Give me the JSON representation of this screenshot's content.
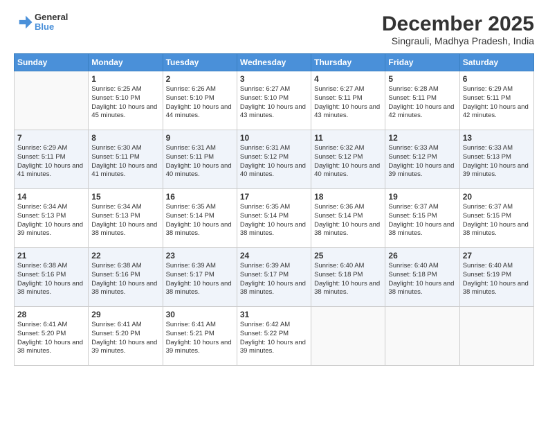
{
  "logo": {
    "line1": "General",
    "line2": "Blue"
  },
  "title": "December 2025",
  "subtitle": "Singrauli, Madhya Pradesh, India",
  "headers": [
    "Sunday",
    "Monday",
    "Tuesday",
    "Wednesday",
    "Thursday",
    "Friday",
    "Saturday"
  ],
  "weeks": [
    [
      {
        "day": "",
        "info": ""
      },
      {
        "day": "1",
        "info": "Sunrise: 6:25 AM\nSunset: 5:10 PM\nDaylight: 10 hours and 45 minutes."
      },
      {
        "day": "2",
        "info": "Sunrise: 6:26 AM\nSunset: 5:10 PM\nDaylight: 10 hours and 44 minutes."
      },
      {
        "day": "3",
        "info": "Sunrise: 6:27 AM\nSunset: 5:10 PM\nDaylight: 10 hours and 43 minutes."
      },
      {
        "day": "4",
        "info": "Sunrise: 6:27 AM\nSunset: 5:11 PM\nDaylight: 10 hours and 43 minutes."
      },
      {
        "day": "5",
        "info": "Sunrise: 6:28 AM\nSunset: 5:11 PM\nDaylight: 10 hours and 42 minutes."
      },
      {
        "day": "6",
        "info": "Sunrise: 6:29 AM\nSunset: 5:11 PM\nDaylight: 10 hours and 42 minutes."
      }
    ],
    [
      {
        "day": "7",
        "info": "Sunrise: 6:29 AM\nSunset: 5:11 PM\nDaylight: 10 hours and 41 minutes."
      },
      {
        "day": "8",
        "info": "Sunrise: 6:30 AM\nSunset: 5:11 PM\nDaylight: 10 hours and 41 minutes."
      },
      {
        "day": "9",
        "info": "Sunrise: 6:31 AM\nSunset: 5:11 PM\nDaylight: 10 hours and 40 minutes."
      },
      {
        "day": "10",
        "info": "Sunrise: 6:31 AM\nSunset: 5:12 PM\nDaylight: 10 hours and 40 minutes."
      },
      {
        "day": "11",
        "info": "Sunrise: 6:32 AM\nSunset: 5:12 PM\nDaylight: 10 hours and 40 minutes."
      },
      {
        "day": "12",
        "info": "Sunrise: 6:33 AM\nSunset: 5:12 PM\nDaylight: 10 hours and 39 minutes."
      },
      {
        "day": "13",
        "info": "Sunrise: 6:33 AM\nSunset: 5:13 PM\nDaylight: 10 hours and 39 minutes."
      }
    ],
    [
      {
        "day": "14",
        "info": "Sunrise: 6:34 AM\nSunset: 5:13 PM\nDaylight: 10 hours and 39 minutes."
      },
      {
        "day": "15",
        "info": "Sunrise: 6:34 AM\nSunset: 5:13 PM\nDaylight: 10 hours and 38 minutes."
      },
      {
        "day": "16",
        "info": "Sunrise: 6:35 AM\nSunset: 5:14 PM\nDaylight: 10 hours and 38 minutes."
      },
      {
        "day": "17",
        "info": "Sunrise: 6:35 AM\nSunset: 5:14 PM\nDaylight: 10 hours and 38 minutes."
      },
      {
        "day": "18",
        "info": "Sunrise: 6:36 AM\nSunset: 5:14 PM\nDaylight: 10 hours and 38 minutes."
      },
      {
        "day": "19",
        "info": "Sunrise: 6:37 AM\nSunset: 5:15 PM\nDaylight: 10 hours and 38 minutes."
      },
      {
        "day": "20",
        "info": "Sunrise: 6:37 AM\nSunset: 5:15 PM\nDaylight: 10 hours and 38 minutes."
      }
    ],
    [
      {
        "day": "21",
        "info": "Sunrise: 6:38 AM\nSunset: 5:16 PM\nDaylight: 10 hours and 38 minutes."
      },
      {
        "day": "22",
        "info": "Sunrise: 6:38 AM\nSunset: 5:16 PM\nDaylight: 10 hours and 38 minutes."
      },
      {
        "day": "23",
        "info": "Sunrise: 6:39 AM\nSunset: 5:17 PM\nDaylight: 10 hours and 38 minutes."
      },
      {
        "day": "24",
        "info": "Sunrise: 6:39 AM\nSunset: 5:17 PM\nDaylight: 10 hours and 38 minutes."
      },
      {
        "day": "25",
        "info": "Sunrise: 6:40 AM\nSunset: 5:18 PM\nDaylight: 10 hours and 38 minutes."
      },
      {
        "day": "26",
        "info": "Sunrise: 6:40 AM\nSunset: 5:18 PM\nDaylight: 10 hours and 38 minutes."
      },
      {
        "day": "27",
        "info": "Sunrise: 6:40 AM\nSunset: 5:19 PM\nDaylight: 10 hours and 38 minutes."
      }
    ],
    [
      {
        "day": "28",
        "info": "Sunrise: 6:41 AM\nSunset: 5:20 PM\nDaylight: 10 hours and 38 minutes."
      },
      {
        "day": "29",
        "info": "Sunrise: 6:41 AM\nSunset: 5:20 PM\nDaylight: 10 hours and 39 minutes."
      },
      {
        "day": "30",
        "info": "Sunrise: 6:41 AM\nSunset: 5:21 PM\nDaylight: 10 hours and 39 minutes."
      },
      {
        "day": "31",
        "info": "Sunrise: 6:42 AM\nSunset: 5:22 PM\nDaylight: 10 hours and 39 minutes."
      },
      {
        "day": "",
        "info": ""
      },
      {
        "day": "",
        "info": ""
      },
      {
        "day": "",
        "info": ""
      }
    ]
  ]
}
